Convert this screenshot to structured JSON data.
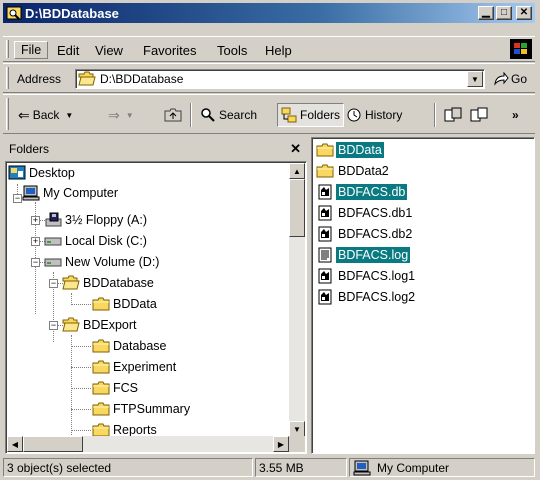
{
  "window": {
    "title": "D:\\BDDatabase"
  },
  "menu": [
    "File",
    "Edit",
    "View",
    "Favorites",
    "Tools",
    "Help"
  ],
  "address": {
    "label": "Address",
    "path": "D:\\BDDatabase",
    "go_label": "Go"
  },
  "toolbar": {
    "back": "Back",
    "search": "Search",
    "folders": "Folders",
    "history": "History"
  },
  "folders_pane": {
    "title": "Folders",
    "tree": [
      {
        "label": "Desktop",
        "icon": "desktop-icon"
      },
      {
        "label": "My Computer",
        "icon": "my-computer-icon"
      },
      {
        "label": "3½ Floppy (A:)",
        "icon": "floppy-icon"
      },
      {
        "label": "Local Disk (C:)",
        "icon": "drive-icon"
      },
      {
        "label": "New Volume (D:)",
        "icon": "drive-icon"
      },
      {
        "label": "BDDatabase",
        "icon": "folder-open-icon"
      },
      {
        "label": "BDData",
        "icon": "folder-icon"
      },
      {
        "label": "BDExport",
        "icon": "folder-open-icon"
      },
      {
        "label": "Database",
        "icon": "folder-icon"
      },
      {
        "label": "Experiment",
        "icon": "folder-icon"
      },
      {
        "label": "FCS",
        "icon": "folder-icon"
      },
      {
        "label": "FTPSummary",
        "icon": "folder-icon"
      },
      {
        "label": "Reports",
        "icon": "folder-icon"
      }
    ]
  },
  "files": [
    {
      "name": "BDData",
      "icon": "folder-icon",
      "selected": true
    },
    {
      "name": "BDData2",
      "icon": "folder-icon",
      "selected": false
    },
    {
      "name": "BDFACS.db",
      "icon": "db-file-icon",
      "selected": true
    },
    {
      "name": "BDFACS.db1",
      "icon": "db-file-icon",
      "selected": false
    },
    {
      "name": "BDFACS.db2",
      "icon": "db-file-icon",
      "selected": false
    },
    {
      "name": "BDFACS.log",
      "icon": "text-file-icon",
      "selected": true
    },
    {
      "name": "BDFACS.log1",
      "icon": "db-file-icon",
      "selected": false
    },
    {
      "name": "BDFACS.log2",
      "icon": "db-file-icon",
      "selected": false
    }
  ],
  "status": {
    "selection": "3 object(s) selected",
    "size": "3.55 MB",
    "zone": "My Computer"
  },
  "colors": {
    "selection": "#0a7a82",
    "title_start": "#0a246a",
    "title_end": "#a6caf0",
    "folder": "#f8d860"
  }
}
